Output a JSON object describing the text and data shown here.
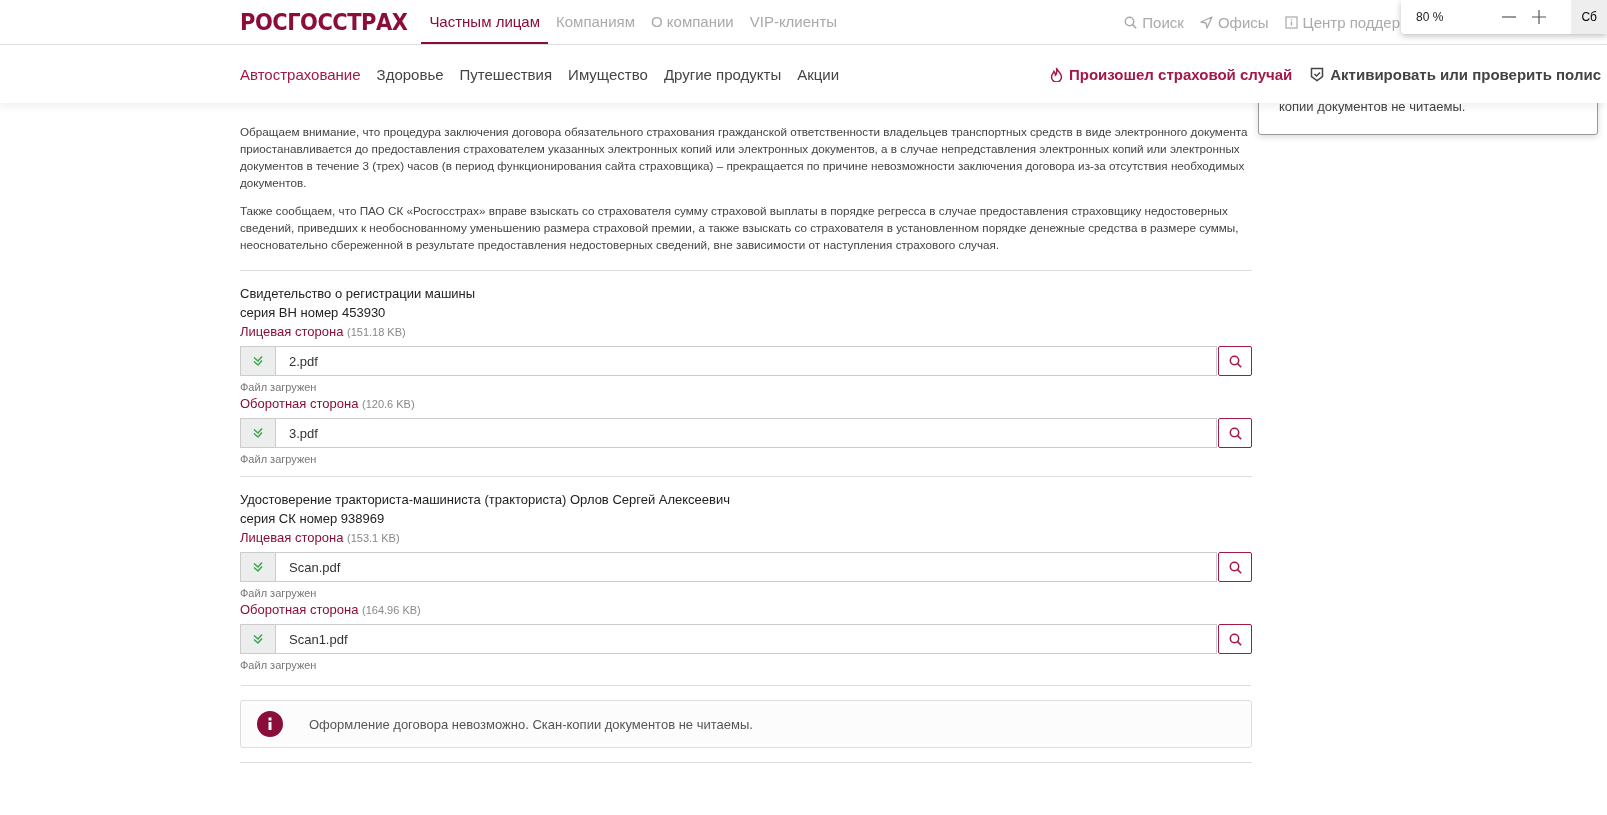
{
  "header": {
    "logo": "РОСГОССТРАХ",
    "nav": [
      {
        "label": "Частным лицам",
        "selected": true
      },
      {
        "label": "Компаниям",
        "selected": false
      },
      {
        "label": "О компании",
        "selected": false
      },
      {
        "label": "VIP-клиенты",
        "selected": false
      }
    ],
    "utilities": [
      {
        "kind": "search",
        "label": "Поиск"
      },
      {
        "kind": "offices",
        "label": "Офисы"
      },
      {
        "kind": "info",
        "label": "Центр поддер"
      }
    ]
  },
  "subnav": {
    "items": [
      {
        "label": "Автострахование",
        "selected": true
      },
      {
        "label": "Здоровье",
        "selected": false
      },
      {
        "label": "Путешествия",
        "selected": false
      },
      {
        "label": "Имущество",
        "selected": false
      },
      {
        "label": "Другие продукты",
        "selected": false
      },
      {
        "label": "Акции",
        "selected": false
      }
    ],
    "actions": [
      {
        "kind": "incident",
        "label": "Произошел страховой случай"
      },
      {
        "kind": "policy",
        "label": "Активировать или проверить полис"
      }
    ]
  },
  "zoom_popup": {
    "value": "80 %",
    "reset": "Сб"
  },
  "tooltip": {
    "text": "копии документов не читаемы."
  },
  "paragraphs": [
    "Обращаем внимание, что процедура заключения договора обязательного страхования гражданской ответственности владельцев транспортных средств в виде электронного документа приостанавливается до предоставления страхователем указанных электронных копий или электронных документов, а в случае непредставления электронных копий или электронных документов в течение 3 (трех) часов (в период функционирования сайта страховщика) – прекращается по причине невозможности заключения договора из-за отсутствия необходимых документов.",
    "Также сообщаем, что ПАО СК «Росгосстрах» вправе взыскать со страхователя сумму страховой выплаты в порядке регресса в случае предоставления страховщику недостоверных сведений, приведших к необоснованному уменьшению размера страховой премии, а также взыскать со страхователя в установленном порядке денежные средства в размере суммы, неосновательно сбереженной в результате предоставления недостоверных сведений, вне зависимости от наступления страхового случая."
  ],
  "documents": [
    {
      "title": "Свидетельство о регистрации машины",
      "series": "серия ВН номер 453930",
      "sides": [
        {
          "label": "Лицевая сторона",
          "size": "(151.18 KB)",
          "file": "2.pdf",
          "uploaded": true,
          "status": "Файл загружен"
        },
        {
          "label": "Оборотная сторона",
          "size": "(120.6 KB)",
          "file": "3.pdf",
          "uploaded": true,
          "status": "Файл загружен"
        }
      ]
    },
    {
      "title": "Удостоверение тракториста-машиниста (тракториста) Орлов Сергей Алексеевич",
      "series": "серия СК номер 938969",
      "sides": [
        {
          "label": "Лицевая сторона",
          "size": "(153.1 KB)",
          "file": "Scan.pdf",
          "uploaded": true,
          "status": "Файл загружен"
        },
        {
          "label": "Оборотная сторона",
          "size": "(164.96 KB)",
          "file": "Scan1.pdf",
          "uploaded": true,
          "status": "Файл загружен"
        }
      ]
    }
  ],
  "alert": {
    "kind": "info",
    "text": "Оформление договора невозможно. Скан-копии документов не читаемы."
  }
}
